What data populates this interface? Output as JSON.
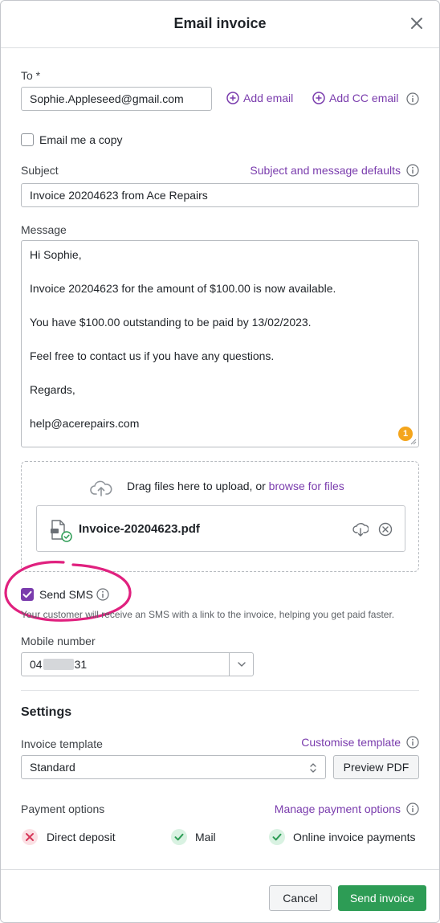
{
  "header": {
    "title": "Email invoice"
  },
  "to": {
    "label": "To *",
    "value": "Sophie.Appleseed@gmail.com",
    "add_email": "Add email",
    "add_cc": "Add CC email"
  },
  "email_copy": {
    "label": "Email me a copy",
    "checked": false
  },
  "subject": {
    "label": "Subject",
    "defaults_link": "Subject and message defaults",
    "value": "Invoice 20204623 from Ace Repairs"
  },
  "message": {
    "label": "Message",
    "lines": [
      "Hi Sophie,",
      "Invoice 20204623 for the amount of $100.00 is now available.",
      "You have $100.00 outstanding to be paid by 13/02/2023.",
      "Feel free to contact us if you have any questions.",
      "Regards,",
      "help@acerepairs.com"
    ],
    "badge": "1"
  },
  "upload": {
    "prompt": "Drag files here to upload, or",
    "browse_link": "browse for files",
    "file_name": "Invoice-20204623.pdf"
  },
  "sms": {
    "label": "Send SMS",
    "checked": true,
    "hint": "Your customer will receive an SMS with a link to the invoice, helping you get paid faster."
  },
  "mobile": {
    "label": "Mobile number",
    "prefix": "04",
    "suffix": "31"
  },
  "settings": {
    "title": "Settings",
    "template_label": "Invoice template",
    "customise_link": "Customise template",
    "template_value": "Standard",
    "preview_button": "Preview PDF",
    "payment_label": "Payment options",
    "manage_link": "Manage payment options",
    "payment_options": [
      {
        "label": "Direct deposit",
        "enabled": false
      },
      {
        "label": "Mail",
        "enabled": true
      },
      {
        "label": "Online invoice payments",
        "enabled": true
      }
    ]
  },
  "footer": {
    "cancel": "Cancel",
    "send": "Send invoice"
  },
  "colors": {
    "accent": "#7a3cad",
    "primary": "#2d9c55",
    "highlight": "#e0217f",
    "badge": "#f4a51c"
  }
}
